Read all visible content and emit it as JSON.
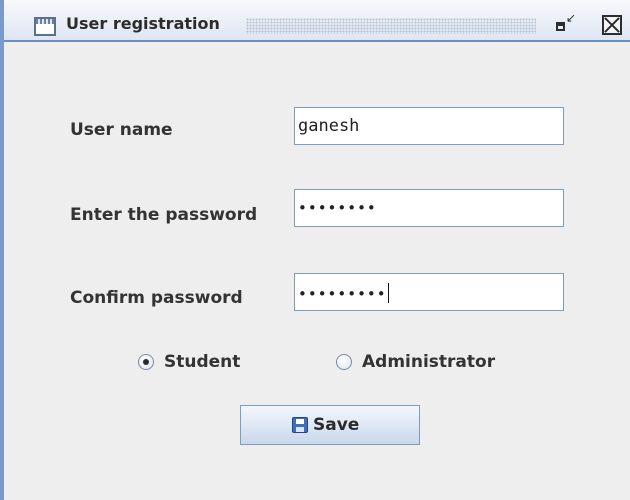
{
  "window": {
    "title": "User registration",
    "icon": "window-icon",
    "restore_icon": "restore-icon",
    "close_icon": "close-icon"
  },
  "form": {
    "username_label": "User name",
    "username_value": "ganesh",
    "password_label": "Enter the password",
    "password_value": "••••••••",
    "confirm_label": "Confirm password",
    "confirm_value": "•••••••••"
  },
  "roles": {
    "options": [
      {
        "label": "Student",
        "selected": true
      },
      {
        "label": "Administrator",
        "selected": false
      }
    ]
  },
  "actions": {
    "save_label": "Save",
    "save_icon": "floppy-disk-icon"
  },
  "colors": {
    "background": "#eeeeee",
    "titlebar_border": "#6b8fc9",
    "field_border": "#7f9db9",
    "button_gradient_bottom": "#c9d8ec"
  }
}
